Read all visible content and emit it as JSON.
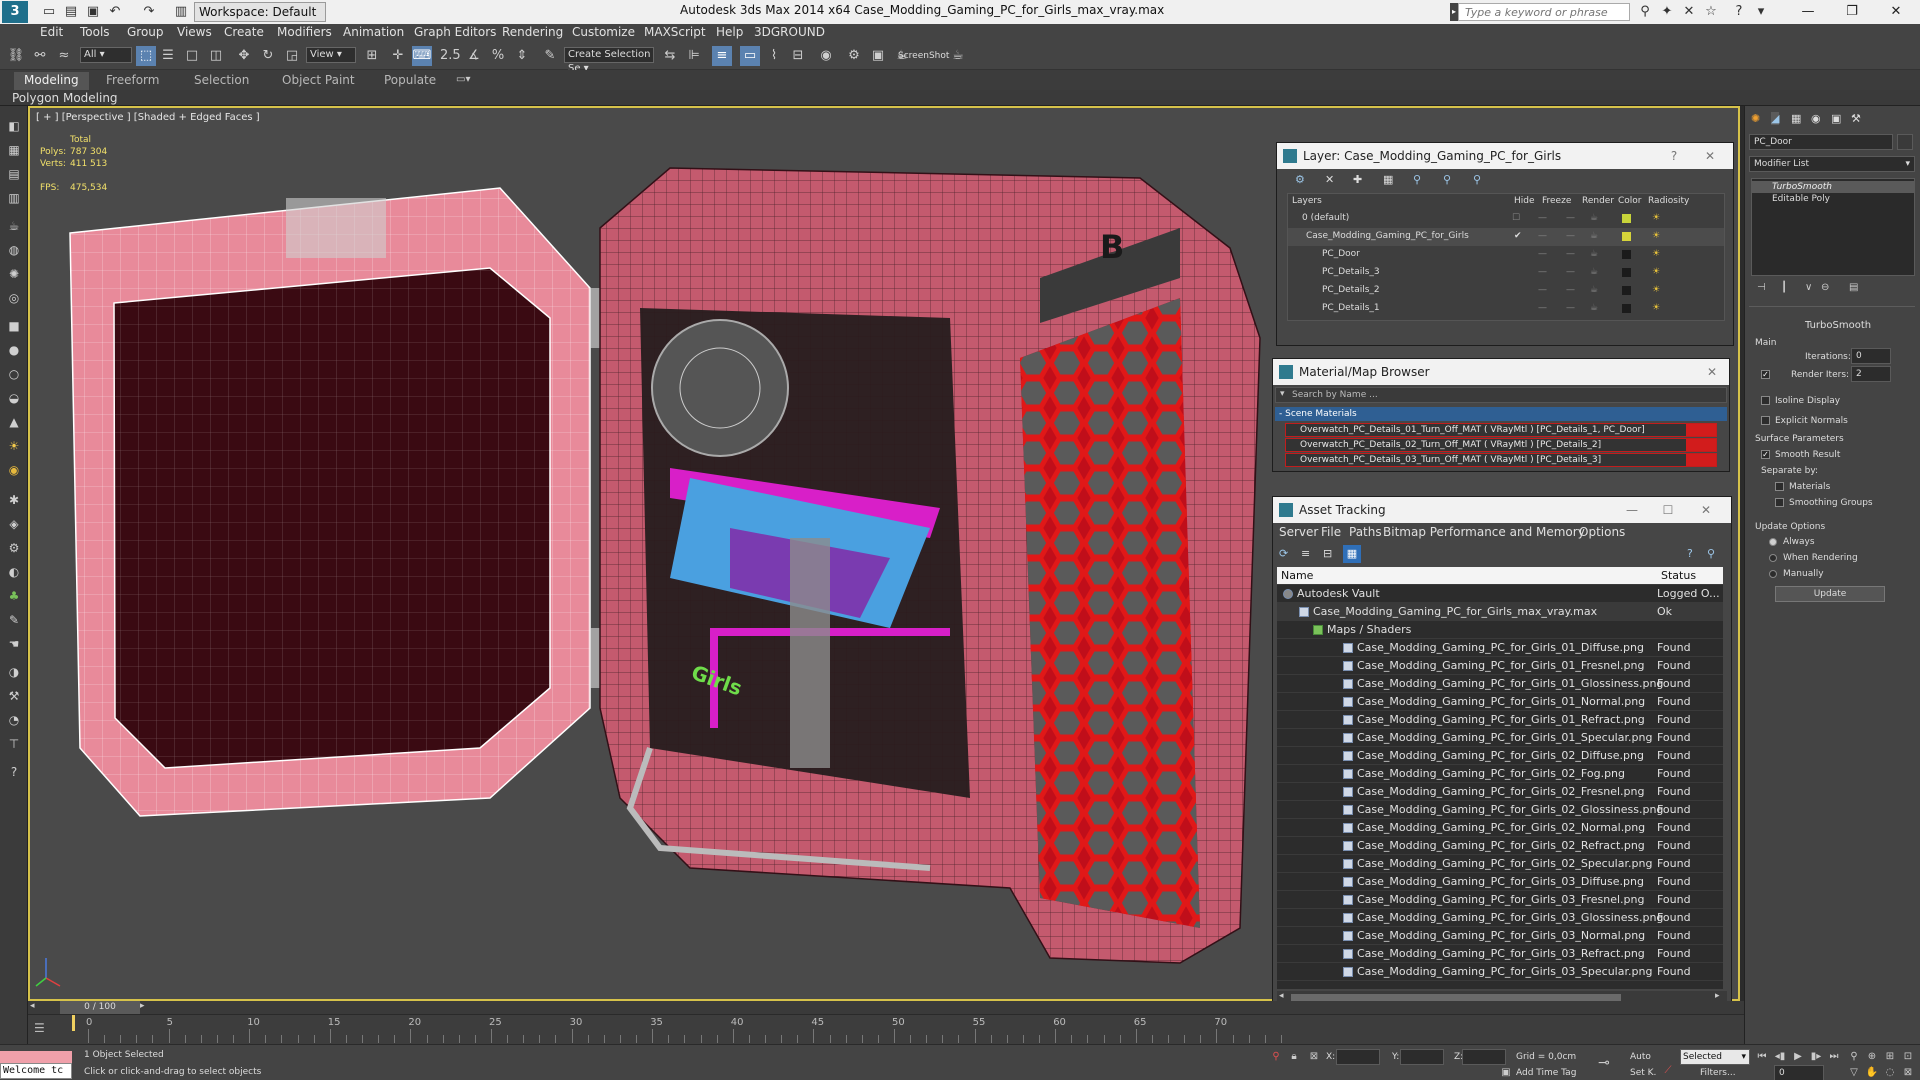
{
  "titlebar": {
    "workspace": "Workspace: Default",
    "title": "Autodesk 3ds Max  2014 x64     Case_Modding_Gaming_PC_for_Girls_max_vray.max",
    "search_placeholder": "Type a keyword or phrase"
  },
  "menu": [
    "Edit",
    "Tools",
    "Group",
    "Views",
    "Create",
    "Modifiers",
    "Animation",
    "Graph Editors",
    "Rendering",
    "Customize",
    "MAXScript",
    "Help",
    "3DGROUND"
  ],
  "toolbar": {
    "filter": "All",
    "ref_coord": "View",
    "selection_set": "Create Selection Se",
    "screenshot_label": "ScreenShot"
  },
  "ribbon": {
    "tabs": [
      "Modeling",
      "Freeform",
      "Selection",
      "Object Paint",
      "Populate"
    ],
    "sub_label": "Polygon Modeling"
  },
  "viewport": {
    "label": "[ + ] [Perspective ] [Shaded + Edged Faces ]",
    "stats": {
      "header": "Total",
      "polys_label": "Polys:",
      "polys": "787 304",
      "verts_label": "Verts:",
      "verts": "411 513",
      "fps_label": "FPS:",
      "fps": "475,534"
    }
  },
  "layer_panel": {
    "title": "Layer: Case_Modding_Gaming_PC_for_Girls",
    "columns": [
      "Layers",
      "Hide",
      "Freeze",
      "Render",
      "Color",
      "Radiosity"
    ],
    "rows": [
      {
        "name": "0 (default)",
        "color": "#c8d43a"
      },
      {
        "name": "Case_Modding_Gaming_PC_for_Girls",
        "color": "#d6d43a"
      },
      {
        "name": "PC_Door",
        "color": "#1b1b1b"
      },
      {
        "name": "PC_Details_3",
        "color": "#1b1b1b"
      },
      {
        "name": "PC_Details_2",
        "color": "#1b1b1b"
      },
      {
        "name": "PC_Details_1",
        "color": "#1b1b1b"
      }
    ]
  },
  "material_panel": {
    "title": "Material/Map Browser",
    "search_placeholder": "Search by Name ...",
    "group": "- Scene Materials",
    "items": [
      "Overwatch_PC_Details_01_Turn_Off_MAT  ( VRayMtl )  [PC_Details_1, PC_Door]",
      "Overwatch_PC_Details_02_Turn_Off_MAT  ( VRayMtl )  [PC_Details_2]",
      "Overwatch_PC_Details_03_Turn_Off_MAT  ( VRayMtl )  [PC_Details_3]"
    ]
  },
  "asset_panel": {
    "title": "Asset Tracking",
    "menu": [
      "Server",
      "File",
      "Paths",
      "Bitmap Performance and Memory",
      "Options"
    ],
    "columns": [
      "Name",
      "Status"
    ],
    "rows": [
      {
        "name": "Autodesk Vault",
        "status": "Logged O..."
      },
      {
        "name": "Case_Modding_Gaming_PC_for_Girls_max_vray.max",
        "status": "Ok"
      },
      {
        "name": "Maps / Shaders",
        "status": ""
      },
      {
        "name": "Case_Modding_Gaming_PC_for_Girls_01_Diffuse.png",
        "status": "Found"
      },
      {
        "name": "Case_Modding_Gaming_PC_for_Girls_01_Fresnel.png",
        "status": "Found"
      },
      {
        "name": "Case_Modding_Gaming_PC_for_Girls_01_Glossiness.png",
        "status": "Found"
      },
      {
        "name": "Case_Modding_Gaming_PC_for_Girls_01_Normal.png",
        "status": "Found"
      },
      {
        "name": "Case_Modding_Gaming_PC_for_Girls_01_Refract.png",
        "status": "Found"
      },
      {
        "name": "Case_Modding_Gaming_PC_for_Girls_01_Specular.png",
        "status": "Found"
      },
      {
        "name": "Case_Modding_Gaming_PC_for_Girls_02_Diffuse.png",
        "status": "Found"
      },
      {
        "name": "Case_Modding_Gaming_PC_for_Girls_02_Fog.png",
        "status": "Found"
      },
      {
        "name": "Case_Modding_Gaming_PC_for_Girls_02_Fresnel.png",
        "status": "Found"
      },
      {
        "name": "Case_Modding_Gaming_PC_for_Girls_02_Glossiness.png",
        "status": "Found"
      },
      {
        "name": "Case_Modding_Gaming_PC_for_Girls_02_Normal.png",
        "status": "Found"
      },
      {
        "name": "Case_Modding_Gaming_PC_for_Girls_02_Refract.png",
        "status": "Found"
      },
      {
        "name": "Case_Modding_Gaming_PC_for_Girls_02_Specular.png",
        "status": "Found"
      },
      {
        "name": "Case_Modding_Gaming_PC_for_Girls_03_Diffuse.png",
        "status": "Found"
      },
      {
        "name": "Case_Modding_Gaming_PC_for_Girls_03_Fresnel.png",
        "status": "Found"
      },
      {
        "name": "Case_Modding_Gaming_PC_for_Girls_03_Glossiness.png",
        "status": "Found"
      },
      {
        "name": "Case_Modding_Gaming_PC_for_Girls_03_Normal.png",
        "status": "Found"
      },
      {
        "name": "Case_Modding_Gaming_PC_for_Girls_03_Refract.png",
        "status": "Found"
      },
      {
        "name": "Case_Modding_Gaming_PC_for_Girls_03_Specular.png",
        "status": "Found"
      }
    ]
  },
  "command_panel": {
    "object_name": "PC_Door",
    "modifier_list": "Modifier List",
    "stack": [
      "TurboSmooth",
      "Editable Poly"
    ],
    "rollout_title": "TurboSmooth",
    "main_label": "Main",
    "iterations_label": "Iterations:",
    "iterations": "0",
    "render_iters_label": "Render Iters:",
    "render_iters": "2",
    "isoline": "Isoline Display",
    "explicit_normals": "Explicit Normals",
    "surface_params": "Surface Parameters",
    "smooth_result": "Smooth Result",
    "separate_by": "Separate by:",
    "materials": "Materials",
    "smoothing_groups": "Smoothing Groups",
    "update_options": "Update Options",
    "always": "Always",
    "when_rendering": "When Rendering",
    "manually": "Manually",
    "update_button": "Update"
  },
  "timeline": {
    "frame": "0 / 100",
    "ticks": [
      "0",
      "5",
      "10",
      "15",
      "20",
      "25",
      "30",
      "35",
      "40",
      "45",
      "50",
      "55",
      "60",
      "65",
      "70"
    ]
  },
  "status": {
    "script_field": "Welcome tc",
    "selected": "1 Object Selected",
    "prompt": "Click or click-and-drag to select objects",
    "x_label": "X:",
    "y_label": "Y:",
    "z_label": "Z:",
    "grid": "Grid = 0,0cm",
    "add_time_tag": "Add Time Tag",
    "auto": "Auto",
    "set_k": "Set K.",
    "key_mode": "Selected",
    "filters": "Filters...",
    "frame_value": "0"
  }
}
